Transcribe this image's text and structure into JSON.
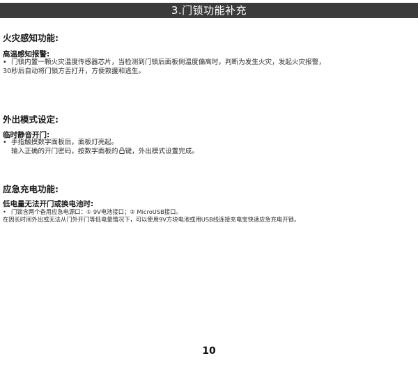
{
  "title": "3.门锁功能补充",
  "sections": {
    "fire": {
      "heading": "火灾感知功能:",
      "sub_heading": "高温感知报警:",
      "bullet": "•",
      "line1": "门锁内置一颗火灾温度传感器芯片，当检测到门锁后面板侧温度偏高时，判断为发生火灾，发起火灾报警，",
      "line2": "30秒后自动将门锁方舌打开，方便救援和逃生。"
    },
    "away": {
      "heading": "外出模式设定:",
      "sub_heading": "临时静音开门:",
      "bullet": "•",
      "line1": "手指触摸数字面板后，面板灯亮起。",
      "line2_before": "输入正确的开门密码，按数字面板的",
      "line2_icon": "lock-icon",
      "line2_after": "键，外出模式设置完成。"
    },
    "emergency": {
      "heading": "应急充电功能:",
      "sub_heading": "低电量无法开门或换电池时:",
      "bullet": "•",
      "line1": "门锁含两个备用应急电源口：① 9V电池接口；② MicroUSB接口。",
      "line2": "在因长时间外出或无法从门外开门等低电量情况下，可以使用9V方块电池或用USB线连接充电宝快速应急充电开锁。"
    }
  },
  "page_number": "10"
}
